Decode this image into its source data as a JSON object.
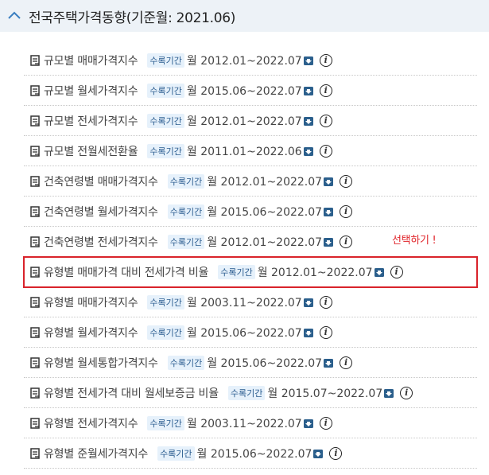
{
  "header": {
    "title": "전국주택가격동향(기준월: 2021.06)"
  },
  "annotation": {
    "text": "선택하기 !",
    "color": "#e0242a"
  },
  "tag_label": "수록기간",
  "rows": [
    {
      "name": "규모별 매매가격지수",
      "period": "월 2012.01~2022.07"
    },
    {
      "name": "규모별 월세가격지수",
      "period": "월 2015.06~2022.07"
    },
    {
      "name": "규모별 전세가격지수",
      "period": "월 2012.01~2022.07"
    },
    {
      "name": "규모별 전월세전환율",
      "period": "월 2011.01~2022.06"
    },
    {
      "name": "건축연령별 매매가격지수",
      "period": "월 2012.01~2022.07"
    },
    {
      "name": "건축연령별 월세가격지수",
      "period": "월 2015.06~2022.07"
    },
    {
      "name": "건축연령별 전세가격지수",
      "period": "월 2012.01~2022.07"
    },
    {
      "name": "유형별 매매가격 대비 전세가격 비율",
      "period": "월 2012.01~2022.07",
      "selected": true
    },
    {
      "name": "유형별 매매가격지수",
      "period": "월 2003.11~2022.07"
    },
    {
      "name": "유형별 월세가격지수",
      "period": "월 2015.06~2022.07"
    },
    {
      "name": "유형별 월세통합가격지수",
      "period": "월 2015.06~2022.07"
    },
    {
      "name": "유형별 전세가격 대비 월세보증금 비율",
      "period": "월 2015.07~2022.07"
    },
    {
      "name": "유형별 전세가격지수",
      "period": "월 2003.11~2022.07"
    },
    {
      "name": "유형별 준월세가격지수",
      "period": "월 2015.06~2022.07"
    }
  ]
}
